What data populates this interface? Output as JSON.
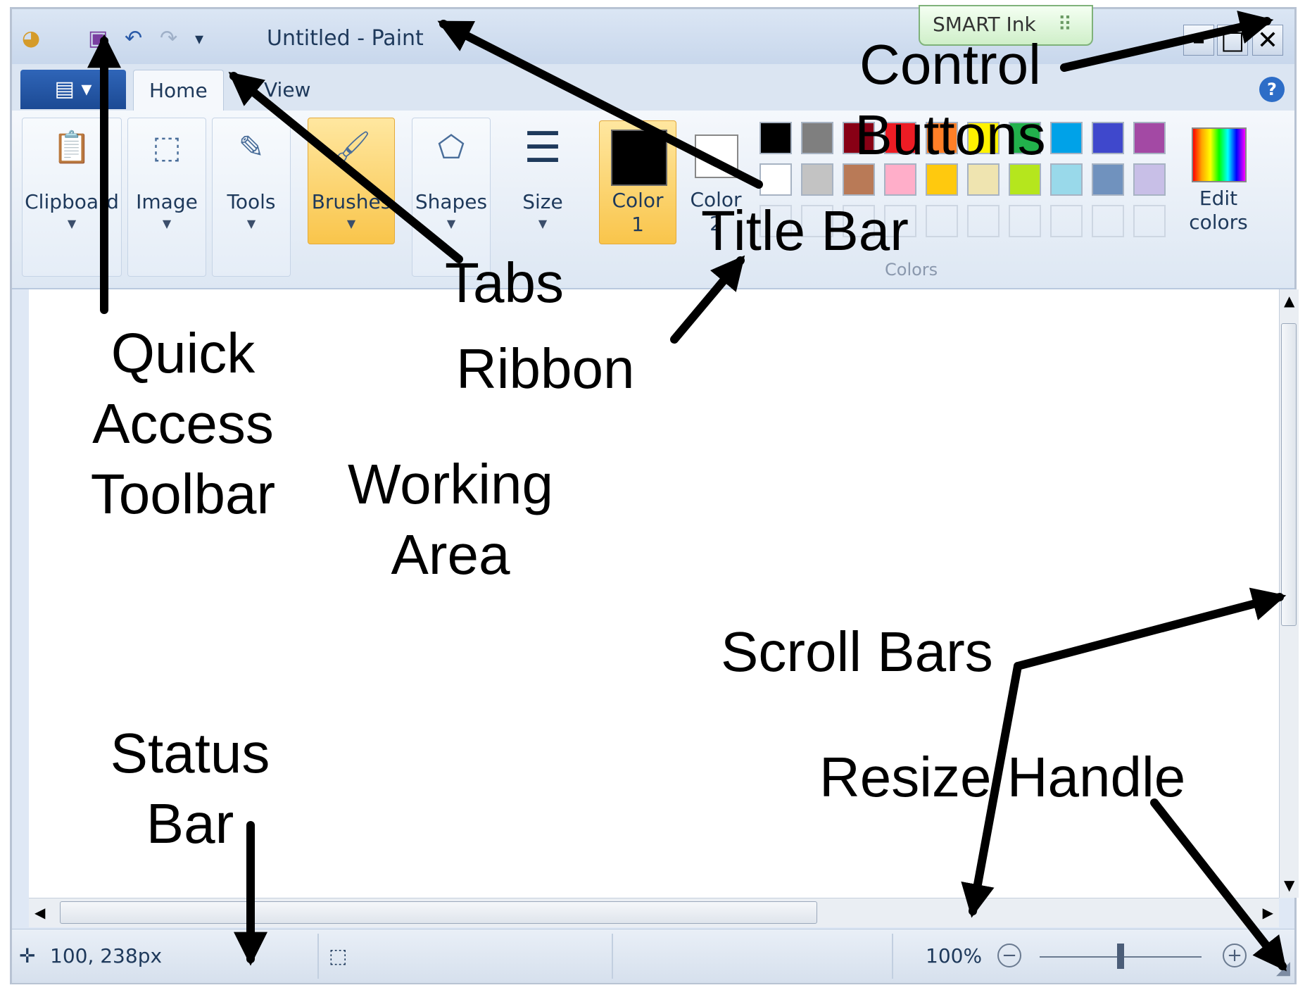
{
  "window": {
    "title": "Untitled - Paint",
    "smart_ink": "SMART Ink",
    "control_buttons": {
      "minimize": "–",
      "maximize": "□",
      "close": "✕"
    }
  },
  "quick_access": {
    "icons": [
      "paint-icon",
      "save-icon",
      "undo-icon",
      "redo-icon",
      "customize-icon"
    ]
  },
  "tabs": {
    "file": "▤ ▾",
    "home": "Home",
    "view": "View",
    "help": "?"
  },
  "ribbon": {
    "groups": [
      {
        "label": "Clipboard",
        "icon": "📋"
      },
      {
        "label": "Image",
        "icon": "⬚"
      },
      {
        "label": "Tools",
        "icon": "✎"
      },
      {
        "label": "Brushes",
        "icon": "🖌"
      },
      {
        "label": "Shapes",
        "icon": "⬠"
      },
      {
        "label": "Size",
        "icon": "☰"
      }
    ],
    "color1": {
      "label_line1": "Color",
      "label_line2": "1"
    },
    "color2": {
      "label_line1": "Color",
      "label_line2": "2"
    },
    "edit_colors": {
      "label_line1": "Edit",
      "label_line2": "colors"
    },
    "colors_group_label": "Colors",
    "palette_row1": [
      "#000000",
      "#7f7f7f",
      "#880015",
      "#ed1c24",
      "#ff7f27",
      "#fff200",
      "#22b14c",
      "#00a2e8",
      "#3f48cc",
      "#a349a4"
    ],
    "palette_row2": [
      "#ffffff",
      "#c3c3c3",
      "#b97a57",
      "#ffaec9",
      "#ffc90e",
      "#efe4b0",
      "#b5e61d",
      "#99d9ea",
      "#7092be",
      "#c8bfe7"
    ]
  },
  "status": {
    "position": "100, 238px",
    "zoom": "100%",
    "zoom_level": 0.5
  },
  "annotations": {
    "control_buttons_line1": "Control",
    "control_buttons_line2": "Buttons",
    "title_bar": "Title Bar",
    "tabs": "Tabs",
    "ribbon": "Ribbon",
    "quick_access_line1": "Quick",
    "quick_access_line2": "Access",
    "quick_access_line3": "Toolbar",
    "working_area_line1": "Working",
    "working_area_line2": "Area",
    "scroll_bars": "Scroll Bars",
    "resize_handle": "Resize Handle",
    "status_bar_line1": "Status",
    "status_bar_line2": "Bar"
  }
}
